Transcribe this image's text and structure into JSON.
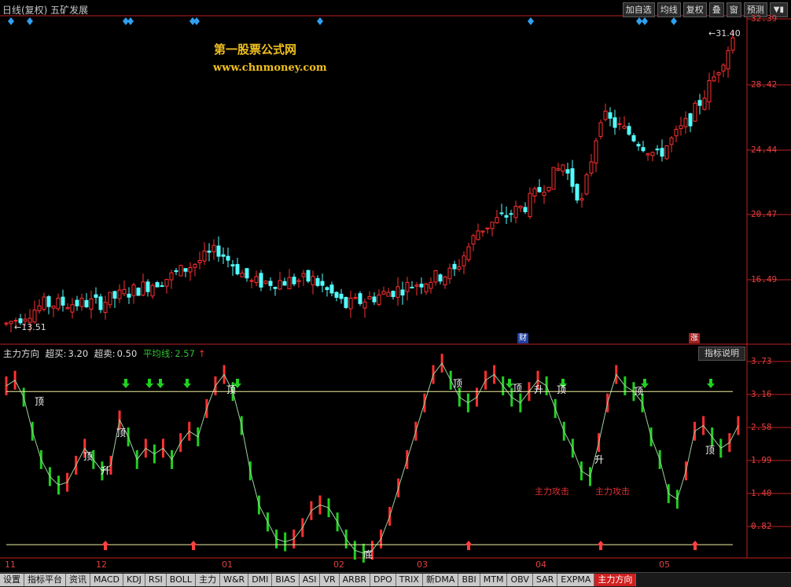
{
  "window": {
    "title": "日线(复权)  五矿发展"
  },
  "toolbar": {
    "buttons": [
      "加自选",
      "均线",
      "复权",
      "叠",
      "窗",
      "预测"
    ],
    "menu_icon": "menu-icon"
  },
  "price_axis": {
    "ticks": [
      "32.39",
      "28.42",
      "24.44",
      "20.47",
      "16.49"
    ]
  },
  "watermark": {
    "line1": "第一股票公式网",
    "line2": "www.chnmoney.com"
  },
  "price_annotations": {
    "high_label": "31.40",
    "low_label": "13.51",
    "badge_cai": "财",
    "badge_zhang": "涨"
  },
  "indicator": {
    "name": "主力方向",
    "overbuy_label": "超买:",
    "overbuy_value": "3.20",
    "oversell_label": "超卖:",
    "oversell_value": "0.50",
    "avg_label": "平均线:",
    "avg_value": "2.57",
    "help_button": "指标说明",
    "axis_ticks": [
      "3.73",
      "3.16",
      "2.58",
      "1.99",
      "1.40",
      "0.82"
    ],
    "signals": {
      "top": "顶",
      "rise": "升",
      "bottom": "底",
      "attack": "主力攻击"
    }
  },
  "time_axis": {
    "labels": [
      "11",
      "12",
      "01",
      "02",
      "03",
      "04",
      "05"
    ]
  },
  "tabs": [
    "设置",
    "指标平台",
    "资讯",
    "MACD",
    "KDJ",
    "RSI",
    "BOLL",
    "主力",
    "W&R",
    "DMI",
    "BIAS",
    "ASI",
    "VR",
    "ARBR",
    "DPO",
    "TRIX",
    "新DMA",
    "BBI",
    "MTM",
    "OBV",
    "SAR",
    "EXPMA",
    "主力方向"
  ],
  "active_tab": "主力方向",
  "colors": {
    "up": "#ff3030",
    "down": "#54ffff",
    "axis": "#c02020",
    "overbuy_line": "#f0f0a0",
    "signal_green": "#20d020"
  }
}
